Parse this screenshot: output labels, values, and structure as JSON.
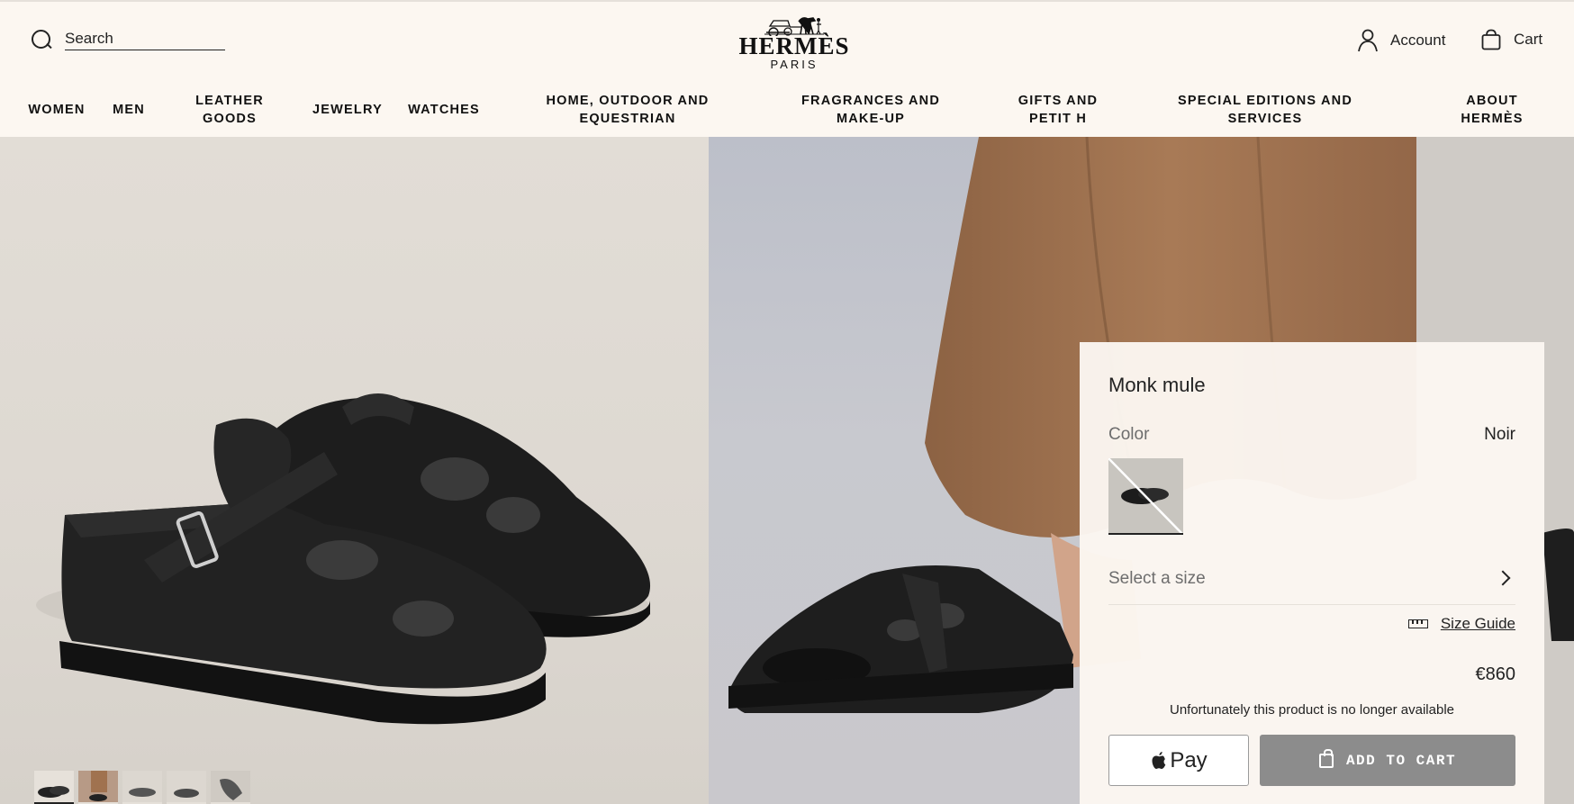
{
  "header": {
    "search_placeholder": "Search",
    "logo_word": "HERMÈS",
    "logo_sub": "PARIS",
    "account_label": "Account",
    "cart_label": "Cart"
  },
  "nav": {
    "items": [
      "WOMEN",
      "MEN",
      "LEATHER GOODS",
      "JEWELRY",
      "WATCHES",
      "HOME, OUTDOOR AND EQUESTRIAN",
      "FRAGRANCES AND MAKE-UP",
      "GIFTS AND PETIT H",
      "SPECIAL EDITIONS AND SERVICES",
      "ABOUT HERMÈS"
    ]
  },
  "gallery": {
    "thumbnail_count": 5,
    "active_index": 0
  },
  "product": {
    "title": "Monk mule",
    "color_label": "Color",
    "color_value": "Noir",
    "size_label": "Select a size",
    "size_guide": "Size Guide",
    "price": "€860",
    "availability": "Unfortunately this product is no longer available",
    "apple_pay_label": "Pay",
    "add_to_cart": "ADD TO CART"
  },
  "colors": {
    "background": "#fcf7f1",
    "button_disabled": "#8c8c8c",
    "trouser": "#a0724f",
    "shoe": "#1e1e1e"
  }
}
